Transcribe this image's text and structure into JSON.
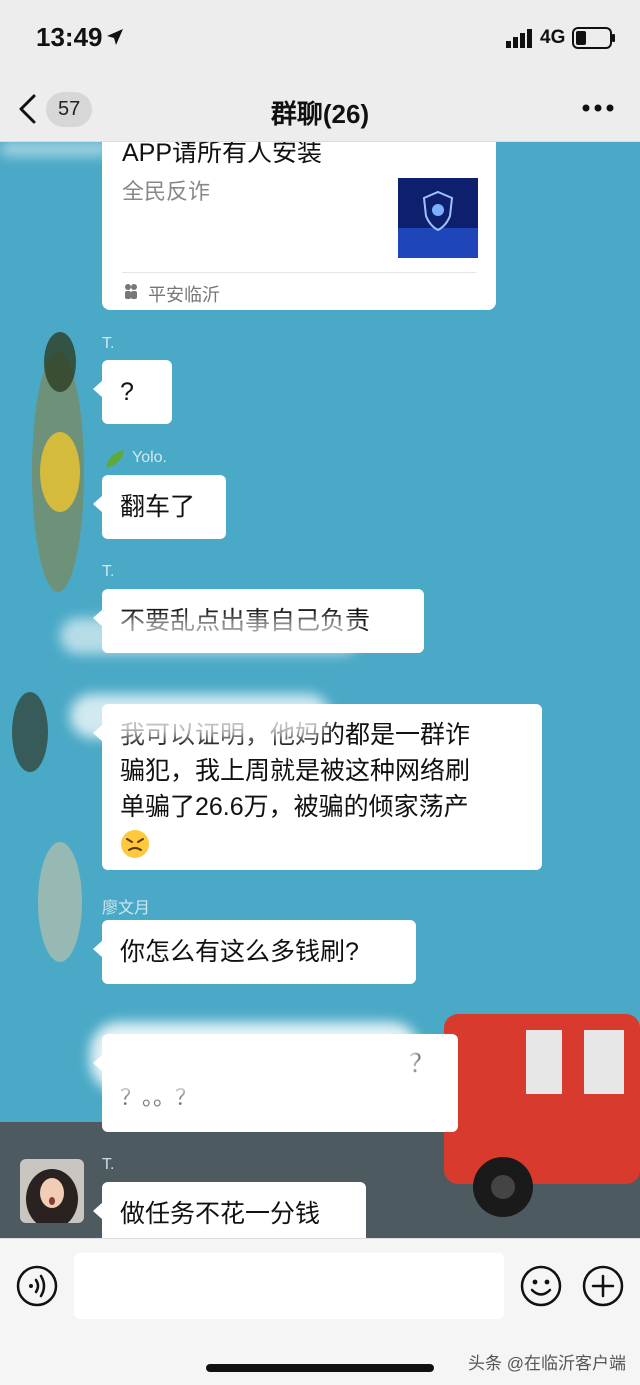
{
  "status_bar": {
    "time": "13:49",
    "network": "4G"
  },
  "nav": {
    "unread_count": "57",
    "title": "群聊(26)"
  },
  "card": {
    "title": "APP请所有人安装",
    "subtitle": "全民反诈",
    "source": "平安临沂"
  },
  "messages": [
    {
      "sender": "T.",
      "text": "?"
    },
    {
      "sender": "Yolo.",
      "text": "翻车了"
    },
    {
      "sender": "T.",
      "text": "不要乱点出事自己负责"
    },
    {
      "sender": "",
      "lines": [
        "我可以证明，他妈的都是一群诈",
        "骗犯，我上周就是被这种网络刷",
        "单骗了26.6万，被骗的倾家荡产"
      ]
    },
    {
      "sender": "廖文月",
      "text": "你怎么有这么多钱刷?"
    },
    {
      "sender": "",
      "lines": [
        "？",
        "？。。？"
      ]
    },
    {
      "sender": "T.",
      "text": "做任务不花一分钱"
    }
  ],
  "watermark": "头条 @在临沂客户端",
  "colors": {
    "chat_bg": "#4aa9c6",
    "bubble": "#ffffff",
    "nav_bg": "#ededed",
    "truck_red": "#d83a2e"
  }
}
